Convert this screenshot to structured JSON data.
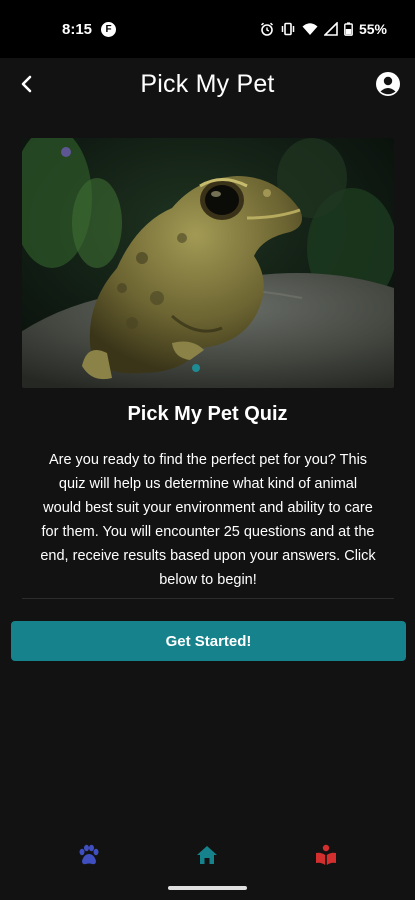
{
  "status_bar": {
    "time": "8:15",
    "battery_percent": "55%",
    "icons": [
      "f-app-icon",
      "alarm-icon",
      "vibrate-icon",
      "wifi-icon",
      "signal-icon",
      "battery-icon"
    ]
  },
  "app_bar": {
    "title": "Pick My Pet",
    "back_icon": "back-arrow-icon",
    "profile_icon": "account-circle-icon"
  },
  "hero": {
    "image_subject": "toad on a rock",
    "carousel_active_index": 0
  },
  "quiz": {
    "title": "Pick My Pet Quiz",
    "description": "Are you ready to find the perfect pet for you? This quiz will help us determine what kind of animal would best suit your environment and ability to care for them. You will encounter 25 questions and at the end, receive results based upon your answers. Click below to begin!",
    "start_button": "Get Started!"
  },
  "bottom_nav": {
    "items": [
      {
        "icon": "paw-icon",
        "color": "#3f4fbf"
      },
      {
        "icon": "home-icon",
        "color": "#16838c"
      },
      {
        "icon": "book-reader-icon",
        "color": "#d32f2f"
      }
    ]
  },
  "colors": {
    "background": "#121212",
    "accent": "#16838c",
    "status_bar": "#000000"
  }
}
